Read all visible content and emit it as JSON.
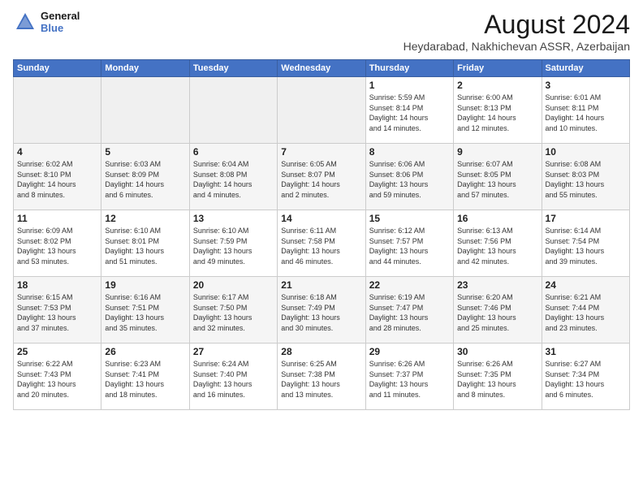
{
  "logo": {
    "line1": "General",
    "line2": "Blue"
  },
  "title": "August 2024",
  "location": "Heydarabad, Nakhichevan ASSR, Azerbaijan",
  "weekdays": [
    "Sunday",
    "Monday",
    "Tuesday",
    "Wednesday",
    "Thursday",
    "Friday",
    "Saturday"
  ],
  "weeks": [
    [
      {
        "day": "",
        "info": ""
      },
      {
        "day": "",
        "info": ""
      },
      {
        "day": "",
        "info": ""
      },
      {
        "day": "",
        "info": ""
      },
      {
        "day": "1",
        "info": "Sunrise: 5:59 AM\nSunset: 8:14 PM\nDaylight: 14 hours\nand 14 minutes."
      },
      {
        "day": "2",
        "info": "Sunrise: 6:00 AM\nSunset: 8:13 PM\nDaylight: 14 hours\nand 12 minutes."
      },
      {
        "day": "3",
        "info": "Sunrise: 6:01 AM\nSunset: 8:11 PM\nDaylight: 14 hours\nand 10 minutes."
      }
    ],
    [
      {
        "day": "4",
        "info": "Sunrise: 6:02 AM\nSunset: 8:10 PM\nDaylight: 14 hours\nand 8 minutes."
      },
      {
        "day": "5",
        "info": "Sunrise: 6:03 AM\nSunset: 8:09 PM\nDaylight: 14 hours\nand 6 minutes."
      },
      {
        "day": "6",
        "info": "Sunrise: 6:04 AM\nSunset: 8:08 PM\nDaylight: 14 hours\nand 4 minutes."
      },
      {
        "day": "7",
        "info": "Sunrise: 6:05 AM\nSunset: 8:07 PM\nDaylight: 14 hours\nand 2 minutes."
      },
      {
        "day": "8",
        "info": "Sunrise: 6:06 AM\nSunset: 8:06 PM\nDaylight: 13 hours\nand 59 minutes."
      },
      {
        "day": "9",
        "info": "Sunrise: 6:07 AM\nSunset: 8:05 PM\nDaylight: 13 hours\nand 57 minutes."
      },
      {
        "day": "10",
        "info": "Sunrise: 6:08 AM\nSunset: 8:03 PM\nDaylight: 13 hours\nand 55 minutes."
      }
    ],
    [
      {
        "day": "11",
        "info": "Sunrise: 6:09 AM\nSunset: 8:02 PM\nDaylight: 13 hours\nand 53 minutes."
      },
      {
        "day": "12",
        "info": "Sunrise: 6:10 AM\nSunset: 8:01 PM\nDaylight: 13 hours\nand 51 minutes."
      },
      {
        "day": "13",
        "info": "Sunrise: 6:10 AM\nSunset: 7:59 PM\nDaylight: 13 hours\nand 49 minutes."
      },
      {
        "day": "14",
        "info": "Sunrise: 6:11 AM\nSunset: 7:58 PM\nDaylight: 13 hours\nand 46 minutes."
      },
      {
        "day": "15",
        "info": "Sunrise: 6:12 AM\nSunset: 7:57 PM\nDaylight: 13 hours\nand 44 minutes."
      },
      {
        "day": "16",
        "info": "Sunrise: 6:13 AM\nSunset: 7:56 PM\nDaylight: 13 hours\nand 42 minutes."
      },
      {
        "day": "17",
        "info": "Sunrise: 6:14 AM\nSunset: 7:54 PM\nDaylight: 13 hours\nand 39 minutes."
      }
    ],
    [
      {
        "day": "18",
        "info": "Sunrise: 6:15 AM\nSunset: 7:53 PM\nDaylight: 13 hours\nand 37 minutes."
      },
      {
        "day": "19",
        "info": "Sunrise: 6:16 AM\nSunset: 7:51 PM\nDaylight: 13 hours\nand 35 minutes."
      },
      {
        "day": "20",
        "info": "Sunrise: 6:17 AM\nSunset: 7:50 PM\nDaylight: 13 hours\nand 32 minutes."
      },
      {
        "day": "21",
        "info": "Sunrise: 6:18 AM\nSunset: 7:49 PM\nDaylight: 13 hours\nand 30 minutes."
      },
      {
        "day": "22",
        "info": "Sunrise: 6:19 AM\nSunset: 7:47 PM\nDaylight: 13 hours\nand 28 minutes."
      },
      {
        "day": "23",
        "info": "Sunrise: 6:20 AM\nSunset: 7:46 PM\nDaylight: 13 hours\nand 25 minutes."
      },
      {
        "day": "24",
        "info": "Sunrise: 6:21 AM\nSunset: 7:44 PM\nDaylight: 13 hours\nand 23 minutes."
      }
    ],
    [
      {
        "day": "25",
        "info": "Sunrise: 6:22 AM\nSunset: 7:43 PM\nDaylight: 13 hours\nand 20 minutes."
      },
      {
        "day": "26",
        "info": "Sunrise: 6:23 AM\nSunset: 7:41 PM\nDaylight: 13 hours\nand 18 minutes."
      },
      {
        "day": "27",
        "info": "Sunrise: 6:24 AM\nSunset: 7:40 PM\nDaylight: 13 hours\nand 16 minutes."
      },
      {
        "day": "28",
        "info": "Sunrise: 6:25 AM\nSunset: 7:38 PM\nDaylight: 13 hours\nand 13 minutes."
      },
      {
        "day": "29",
        "info": "Sunrise: 6:26 AM\nSunset: 7:37 PM\nDaylight: 13 hours\nand 11 minutes."
      },
      {
        "day": "30",
        "info": "Sunrise: 6:26 AM\nSunset: 7:35 PM\nDaylight: 13 hours\nand 8 minutes."
      },
      {
        "day": "31",
        "info": "Sunrise: 6:27 AM\nSunset: 7:34 PM\nDaylight: 13 hours\nand 6 minutes."
      }
    ]
  ]
}
